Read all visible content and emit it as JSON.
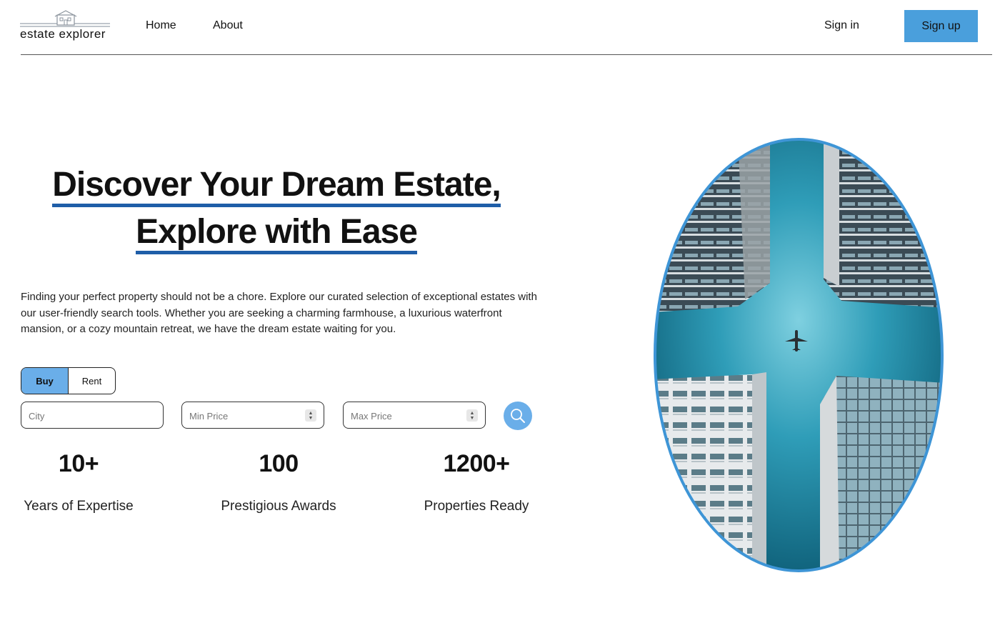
{
  "brand": {
    "name": "estate explorer"
  },
  "nav": {
    "home": "Home",
    "about": "About",
    "sign_in": "Sign in",
    "sign_up": "Sign up"
  },
  "hero": {
    "title_line1": "Discover Your Dream Estate,",
    "title_line2": "Explore with Ease",
    "description": "Finding your perfect property should not be a chore. Explore our curated selection of exceptional estates with our user-friendly search tools. Whether you are seeking a charming farmhouse, a luxurious waterfront mansion, or a cozy mountain retreat, we have the dream estate waiting for you."
  },
  "search": {
    "mode_selected": "Buy",
    "modes": [
      "Buy",
      "Rent"
    ],
    "city_placeholder": "City",
    "min_price_placeholder": "Min Price",
    "max_price_placeholder": "Max Price"
  },
  "stats": [
    {
      "value": "10+",
      "label": "Years of Expertise"
    },
    {
      "value": "100",
      "label": "Prestigious Awards"
    },
    {
      "value": "1200+",
      "label": "Properties Ready"
    }
  ],
  "colors": {
    "accent": "#4a9fdc",
    "accent_light": "#6aaee9",
    "underline": "#1f5ea8",
    "sky": "#1e90a8"
  }
}
